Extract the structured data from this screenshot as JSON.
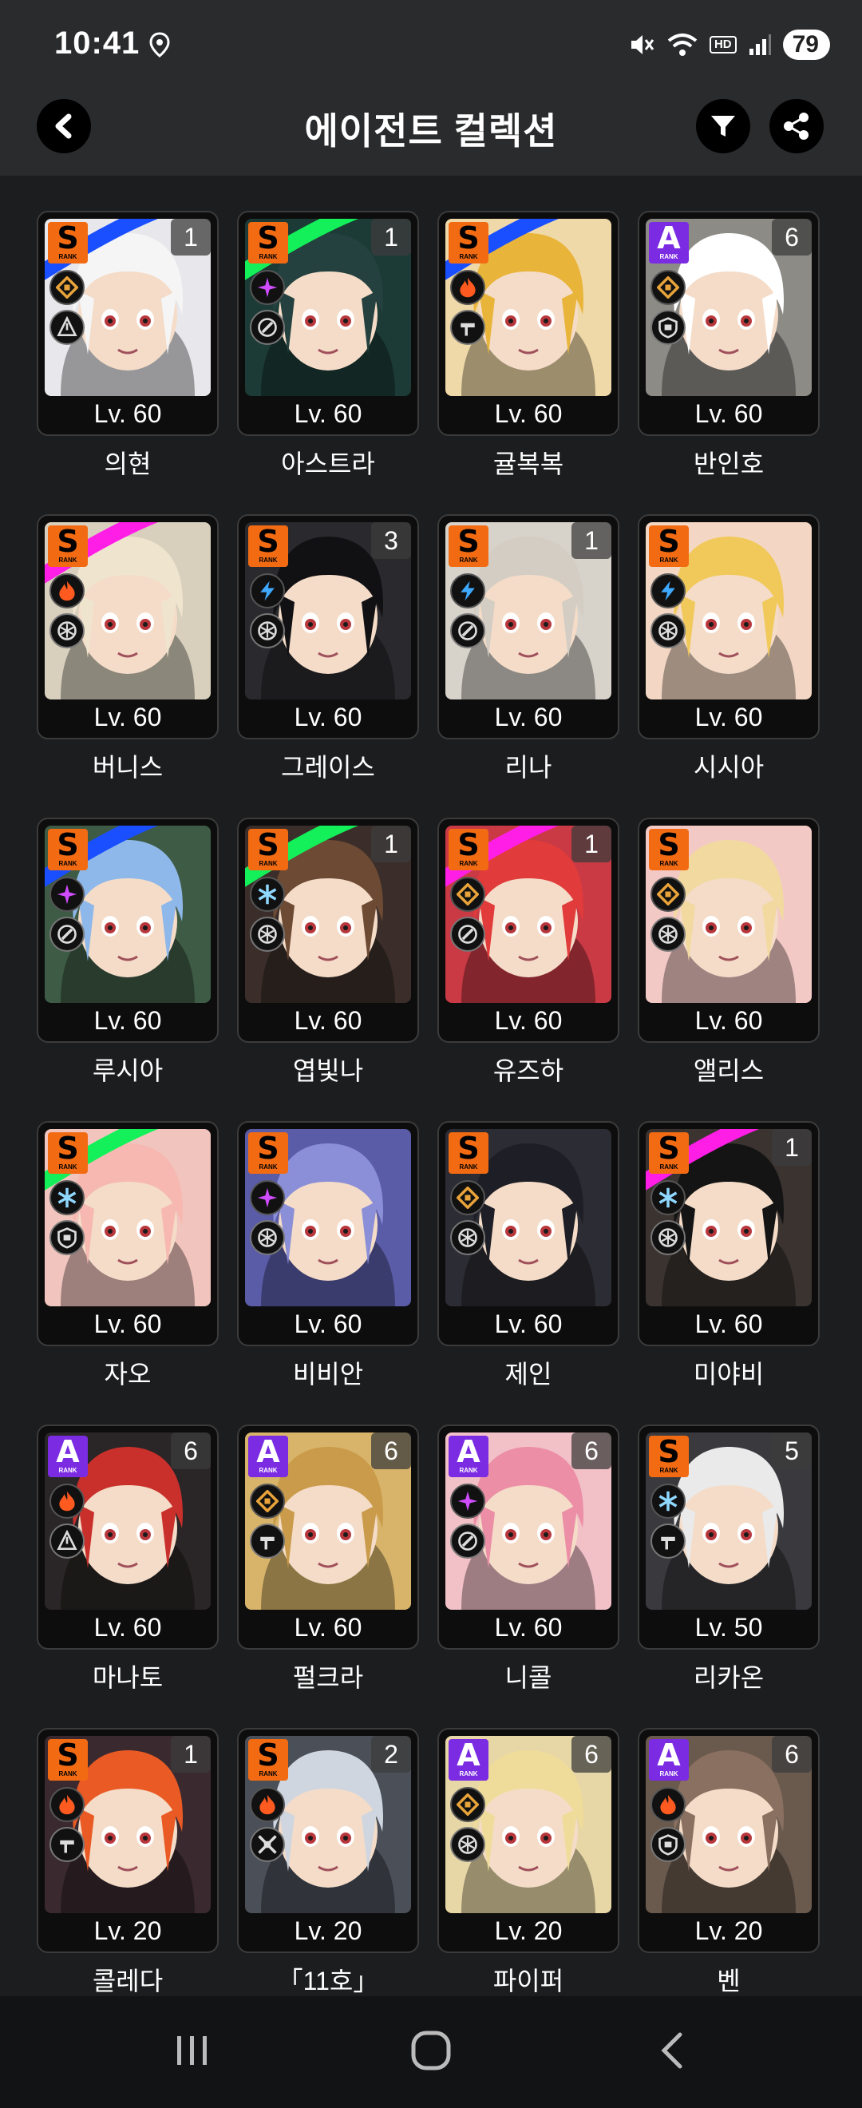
{
  "status_bar": {
    "time": "10:41",
    "hd_label": "HD",
    "battery": "79"
  },
  "header": {
    "title": "에이전트 컬렉션"
  },
  "colors": {
    "rank_s": "#f26b13",
    "rank_a": "#7b2be2",
    "attr_physical": "#e8a33a",
    "attr_ice": "#8fd8ff",
    "attr_fire": "#ff5a1f",
    "attr_electric": "#3fa9ff",
    "attr_ether": "#d04cff",
    "scribble_blue": "#1a4fff",
    "scribble_green": "#14f05a",
    "scribble_magenta": "#ff1ee6"
  },
  "agents": [
    {
      "name": "의현",
      "level": "Lv. 60",
      "rank": "S",
      "rank_sub": "RANK",
      "count": "1",
      "attribute": "physical-icon",
      "specialty": "rupture-icon",
      "bg": "#e8e8ec",
      "hair": "#f5f5f5",
      "scribble": "blue"
    },
    {
      "name": "아스트라",
      "level": "Lv. 60",
      "rank": "S",
      "rank_sub": "RANK",
      "count": "1",
      "attribute": "ether-icon",
      "specialty": "support-icon",
      "bg": "#1c3b36",
      "hair": "#24403f",
      "scribble": "green"
    },
    {
      "name": "귤복복",
      "level": "Lv. 60",
      "rank": "S",
      "rank_sub": "RANK",
      "count": "",
      "attribute": "fire-icon",
      "specialty": "stun-icon",
      "bg": "#f0d9a8",
      "hair": "#e9b43a",
      "scribble": "blue"
    },
    {
      "name": "반인호",
      "level": "Lv. 60",
      "rank": "A",
      "rank_sub": "RANK",
      "count": "6",
      "attribute": "physical-icon",
      "specialty": "defense-icon",
      "bg": "#8d8b86",
      "hair": "#ffffff",
      "scribble": ""
    },
    {
      "name": "버니스",
      "level": "Lv. 60",
      "rank": "S",
      "rank_sub": "RANK",
      "count": "",
      "attribute": "fire-icon",
      "specialty": "anomaly-icon",
      "bg": "#d8cfbd",
      "hair": "#efe5cf",
      "scribble": "magenta"
    },
    {
      "name": "그레이스",
      "level": "Lv. 60",
      "rank": "S",
      "rank_sub": "RANK",
      "count": "3",
      "attribute": "electric-icon",
      "specialty": "anomaly-icon",
      "bg": "#2a2a2e",
      "hair": "#111114",
      "scribble": ""
    },
    {
      "name": "리나",
      "level": "Lv. 60",
      "rank": "S",
      "rank_sub": "RANK",
      "count": "1",
      "attribute": "electric-icon",
      "specialty": "support-icon",
      "bg": "#d7d2ca",
      "hair": "#d3cdc4",
      "scribble": ""
    },
    {
      "name": "시시아",
      "level": "Lv. 60",
      "rank": "S",
      "rank_sub": "RANK",
      "count": "",
      "attribute": "electric-icon",
      "specialty": "anomaly-icon",
      "bg": "#f3d7c4",
      "hair": "#f1c95a",
      "scribble": ""
    },
    {
      "name": "루시아",
      "level": "Lv. 60",
      "rank": "S",
      "rank_sub": "RANK",
      "count": "",
      "attribute": "ether-icon",
      "specialty": "support-icon",
      "bg": "#3e5b45",
      "hair": "#8fb8ea",
      "scribble": "blue"
    },
    {
      "name": "엽빛나",
      "level": "Lv. 60",
      "rank": "S",
      "rank_sub": "RANK",
      "count": "1",
      "attribute": "ice-icon",
      "specialty": "anomaly-icon",
      "bg": "#3b2e2a",
      "hair": "#6d4a34",
      "scribble": "green"
    },
    {
      "name": "유즈하",
      "level": "Lv. 60",
      "rank": "S",
      "rank_sub": "RANK",
      "count": "1",
      "attribute": "physical-icon",
      "specialty": "support-icon",
      "bg": "#c93a45",
      "hair": "#e13b3b",
      "scribble": "magenta"
    },
    {
      "name": "앨리스",
      "level": "Lv. 60",
      "rank": "S",
      "rank_sub": "RANK",
      "count": "",
      "attribute": "physical-icon",
      "specialty": "anomaly-icon",
      "bg": "#f3c9c6",
      "hair": "#f2d9a0",
      "scribble": ""
    },
    {
      "name": "자오",
      "level": "Lv. 60",
      "rank": "S",
      "rank_sub": "RANK",
      "count": "",
      "attribute": "ice-icon",
      "specialty": "defense-icon",
      "bg": "#f1c4bd",
      "hair": "#f6b8b0",
      "scribble": "green"
    },
    {
      "name": "비비안",
      "level": "Lv. 60",
      "rank": "S",
      "rank_sub": "RANK",
      "count": "",
      "attribute": "ether-icon",
      "specialty": "anomaly-icon",
      "bg": "#5a5ca8",
      "hair": "#8a8fd8",
      "scribble": ""
    },
    {
      "name": "제인",
      "level": "Lv. 60",
      "rank": "S",
      "rank_sub": "RANK",
      "count": "",
      "attribute": "physical-icon",
      "specialty": "anomaly-icon",
      "bg": "#2c2c34",
      "hair": "#1e1e26",
      "scribble": ""
    },
    {
      "name": "미야비",
      "level": "Lv. 60",
      "rank": "S",
      "rank_sub": "RANK",
      "count": "1",
      "attribute": "ice-icon",
      "specialty": "anomaly-icon",
      "bg": "#3a3330",
      "hair": "#141414",
      "scribble": "magenta"
    },
    {
      "name": "마나토",
      "level": "Lv. 60",
      "rank": "A",
      "rank_sub": "RANK",
      "count": "6",
      "attribute": "fire-icon",
      "specialty": "rupture-icon",
      "bg": "#2a2526",
      "hair": "#c9302c",
      "scribble": ""
    },
    {
      "name": "펄크라",
      "level": "Lv. 60",
      "rank": "A",
      "rank_sub": "RANK",
      "count": "6",
      "attribute": "physical-icon",
      "specialty": "stun-icon",
      "bg": "#d8b46a",
      "hair": "#c99b4a",
      "scribble": ""
    },
    {
      "name": "니콜",
      "level": "Lv. 60",
      "rank": "A",
      "rank_sub": "RANK",
      "count": "6",
      "attribute": "ether-icon",
      "specialty": "support-icon",
      "bg": "#f2c1c8",
      "hair": "#ec8fa6",
      "scribble": ""
    },
    {
      "name": "리카온",
      "level": "Lv. 50",
      "rank": "S",
      "rank_sub": "RANK",
      "count": "5",
      "attribute": "ice-icon",
      "specialty": "stun-icon",
      "bg": "#3a3a3e",
      "hair": "#eaeaea",
      "scribble": ""
    },
    {
      "name": "콜레다",
      "level": "Lv. 20",
      "rank": "S",
      "rank_sub": "RANK",
      "count": "1",
      "attribute": "fire-icon",
      "specialty": "stun-icon",
      "bg": "#3a2a30",
      "hair": "#ea5a24",
      "scribble": ""
    },
    {
      "name": "「11호」",
      "level": "Lv. 20",
      "rank": "S",
      "rank_sub": "RANK",
      "count": "2",
      "attribute": "fire-icon",
      "specialty": "attack-icon",
      "bg": "#4a4f58",
      "hair": "#cfd6e0",
      "scribble": ""
    },
    {
      "name": "파이퍼",
      "level": "Lv. 20",
      "rank": "A",
      "rank_sub": "RANK",
      "count": "6",
      "attribute": "physical-icon",
      "specialty": "anomaly-icon",
      "bg": "#e8d7a6",
      "hair": "#efdc9a",
      "scribble": ""
    },
    {
      "name": "벤",
      "level": "Lv. 20",
      "rank": "A",
      "rank_sub": "RANK",
      "count": "6",
      "attribute": "fire-icon",
      "specialty": "defense-icon",
      "bg": "#6a5a4e",
      "hair": "#8a7060",
      "scribble": ""
    }
  ],
  "nav": {
    "recent": "recent-apps-icon",
    "home": "home-icon",
    "back": "back-icon"
  }
}
